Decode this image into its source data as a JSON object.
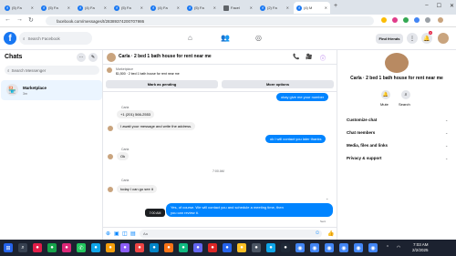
{
  "browser": {
    "tabs": [
      {
        "label": "(5) Fa",
        "active": false,
        "favicon": "facebook-icon"
      },
      {
        "label": "(5) Fa",
        "active": false,
        "favicon": "facebook-icon"
      },
      {
        "label": "(4) Fa",
        "active": false,
        "favicon": "facebook-icon"
      },
      {
        "label": "(5) Fa",
        "active": false,
        "favicon": "facebook-icon"
      },
      {
        "label": "(4) Fa",
        "active": false,
        "favicon": "facebook-icon"
      },
      {
        "label": "(5) Fa",
        "active": false,
        "favicon": "facebook-icon"
      },
      {
        "label": "Facel",
        "active": false,
        "favicon": "doc-icon"
      },
      {
        "label": "(2) Fa",
        "active": false,
        "favicon": "facebook-icon"
      },
      {
        "label": "(4) M",
        "active": true,
        "favicon": "facebook-icon"
      }
    ],
    "url": "facebook.com/messages/t/28389374200707986"
  },
  "fb": {
    "search_placeholder": "Search Facebook",
    "find_friends": "Find friends",
    "notif_count": "4"
  },
  "left": {
    "title": "Chats",
    "search_placeholder": "Search Messenger",
    "item_title": "Marketplace",
    "item_sub": "3m"
  },
  "chat": {
    "title": "Carla · 2 bed 1 bath house for rent near me",
    "listing_seller": "Marketplace",
    "listing_text": "$1,500 · 2 bed 1 bath house for rent near me",
    "mark_pending": "Mark as pending",
    "more_options": "More options",
    "messages": {
      "out1": "okay give me your number",
      "sender1": "Carla",
      "in1": "+1 (201) 566-2553",
      "in2": "I await your message and write the address.",
      "out2": "ok I will contact you later thanks",
      "sender2": "Carla",
      "in3": "Ok",
      "timestamp": "7:00 AM",
      "sender3": "Carla",
      "in4": "today I can go see it",
      "out3_line1": "Yes, of course. We will contact you and schedule a meeting time, then",
      "out3_line2": "you can review it.",
      "tooltip": "7:00 AM",
      "sent": "Sent"
    },
    "composer_placeholder": "Aa"
  },
  "right": {
    "title": "Carla · 2 bed 1 bath house for rent near me",
    "mute": "Mute",
    "search": "Search",
    "sections": [
      "Customize chat",
      "Chat members",
      "Media, files and links",
      "Privacy & support"
    ]
  },
  "taskbar": {
    "time": "7:03 AM",
    "date": "2/2/2025"
  },
  "colors": {
    "accent": "#0084ff",
    "brand": "#1877f2"
  }
}
